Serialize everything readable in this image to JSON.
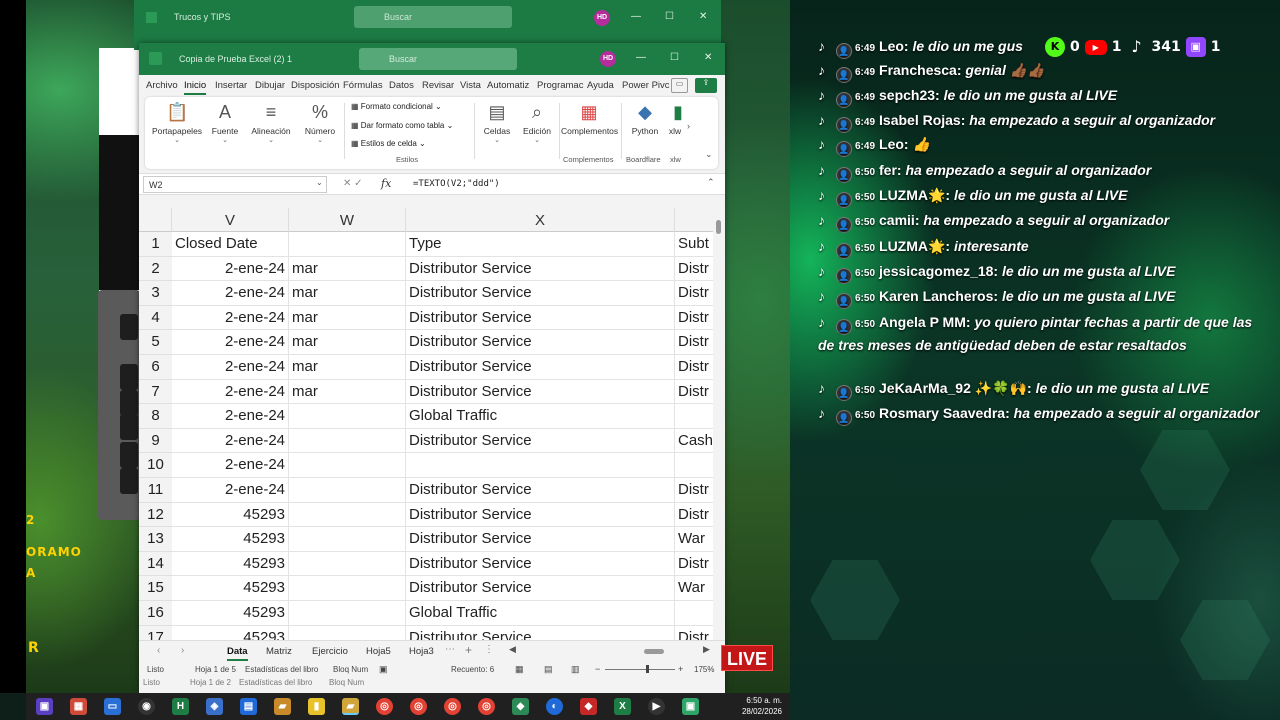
{
  "back_window": {
    "title": "Trucos y TIPS",
    "search": "Buscar",
    "avatar": "HD"
  },
  "window": {
    "title": "Copia de Prueba Excel (2) 1",
    "search": "Buscar",
    "avatar": "HD"
  },
  "ribbon_tabs": [
    "Archivo",
    "Inicio",
    "Insertar",
    "Dibujar",
    "Disposición",
    "Fórmulas",
    "Datos",
    "Revisar",
    "Vista",
    "Automatiz",
    "Programac",
    "Ayuda",
    "Power Pivc"
  ],
  "ribbon": {
    "portapapeles": "Portapapeles",
    "fuente": "Fuente",
    "alineacion": "Alineación",
    "numero": "Número",
    "formato_condicional": "Formato condicional",
    "dar_formato_tabla": "Dar formato como tabla",
    "estilos_celda": "Estilos de celda",
    "estilos": "Estilos",
    "celdas": "Celdas",
    "edicion": "Edición",
    "complementos": "Complementos",
    "complementos_group": "Complementos",
    "python": "Python",
    "boardflare": "Boardflare",
    "xlw": "xlw"
  },
  "formula_bar": {
    "name_box": "W2",
    "fx": "fx",
    "formula": "=TEXTO(V2;\"ddd\")"
  },
  "columns": [
    "V",
    "W",
    "X",
    "Subt"
  ],
  "rows": [
    {
      "n": "1",
      "v": "Closed Date",
      "w": "",
      "x": "Type",
      "y": "Subt"
    },
    {
      "n": "2",
      "v": "2-ene-24",
      "w": "mar",
      "x": "Distributor Service",
      "y": "Distr"
    },
    {
      "n": "3",
      "v": "2-ene-24",
      "w": "mar",
      "x": "Distributor Service",
      "y": "Distr"
    },
    {
      "n": "4",
      "v": "2-ene-24",
      "w": "mar",
      "x": "Distributor Service",
      "y": "Distr"
    },
    {
      "n": "5",
      "v": "2-ene-24",
      "w": "mar",
      "x": "Distributor Service",
      "y": "Distr"
    },
    {
      "n": "6",
      "v": "2-ene-24",
      "w": "mar",
      "x": "Distributor Service",
      "y": "Distr"
    },
    {
      "n": "7",
      "v": "2-ene-24",
      "w": "mar",
      "x": "Distributor Service",
      "y": "Distr"
    },
    {
      "n": "8",
      "v": "2-ene-24",
      "w": "",
      "x": "Global Traffic",
      "y": ""
    },
    {
      "n": "9",
      "v": "2-ene-24",
      "w": "",
      "x": "Distributor Service",
      "y": "Cash"
    },
    {
      "n": "10",
      "v": "2-ene-24",
      "w": "",
      "x": "",
      "y": ""
    },
    {
      "n": "11",
      "v": "2-ene-24",
      "w": "",
      "x": "Distributor Service",
      "y": "Distr"
    },
    {
      "n": "12",
      "v": "45293",
      "w": "",
      "x": "Distributor Service",
      "y": "Distr"
    },
    {
      "n": "13",
      "v": "45293",
      "w": "",
      "x": "Distributor Service",
      "y": "War"
    },
    {
      "n": "14",
      "v": "45293",
      "w": "",
      "x": "Distributor Service",
      "y": "Distr"
    },
    {
      "n": "15",
      "v": "45293",
      "w": "",
      "x": "Distributor Service",
      "y": "War"
    },
    {
      "n": "16",
      "v": "45293",
      "w": "",
      "x": "Global Traffic",
      "y": ""
    },
    {
      "n": "17",
      "v": "45293",
      "w": "",
      "x": "Distributor Service",
      "y": "Distr"
    }
  ],
  "sheet_tabs": [
    "Data",
    "Matriz",
    "Ejercicio",
    "Hoja5",
    "Hoja3"
  ],
  "status": {
    "listo": "Listo",
    "hoja": "Hoja 1 de 5",
    "estadisticas": "Estadísticas del libro",
    "bloq": "Bloq Num",
    "recuento": "Recuento: 6",
    "zoom": "175%",
    "listo2": "Listo",
    "hoja2": "Hoja 1 de 2",
    "estadisticas2": "Estadísticas del libro",
    "bloq2": "Bloq Num"
  },
  "live_badge": "LIVE",
  "side_texts": {
    "a": "2",
    "b": "ORAMO",
    "c": "A",
    "d": "R"
  },
  "taskbar": {
    "time": "6:50 a. m.",
    "date": "28/02/2026"
  },
  "counters": {
    "kick": "0",
    "youtube": "1",
    "tiktok": "341",
    "twitch": "1"
  },
  "chat": [
    {
      "time": "6:49",
      "name": "Leo:",
      "text": "le dio un me gus"
    },
    {
      "time": "6:49",
      "name": "Franchesca:",
      "text": "genial 👍🏾👍🏾"
    },
    {
      "time": "6:49",
      "name": "sepch23:",
      "text": "le dio un me gusta al LIVE"
    },
    {
      "time": "6:49",
      "name": "Isabel Rojas:",
      "text": "ha empezado a seguir al organizador"
    },
    {
      "time": "6:49",
      "name": "Leo:",
      "text": "👍"
    },
    {
      "time": "6:50",
      "name": "fer:",
      "text": "ha empezado a seguir al organizador"
    },
    {
      "time": "6:50",
      "name": "LUZMA🌟:",
      "text": "le dio un me gusta al LIVE"
    },
    {
      "time": "6:50",
      "name": "camii:",
      "text": "ha empezado a seguir al organizador"
    },
    {
      "time": "6:50",
      "name": "LUZMA🌟:",
      "text": "interesante"
    },
    {
      "time": "6:50",
      "name": "jessicagomez_18:",
      "text": "le dio un me gusta al LIVE"
    },
    {
      "time": "6:50",
      "name": "Karen Lancheros:",
      "text": "le dio un me gusta al LIVE"
    },
    {
      "time": "6:50",
      "name": "Angela P MM:",
      "text": "yo quiero pintar fechas a partir de que las de tres meses de antigüedad deben de estar resaltados"
    },
    {
      "time": "6:50",
      "name": "JeKaArMa_92 ✨🍀🙌:",
      "text": "le dio un me gusta al LIVE"
    },
    {
      "time": "6:50",
      "name": "Rosmary Saavedra:",
      "text": "ha empezado a seguir al organizador"
    }
  ]
}
